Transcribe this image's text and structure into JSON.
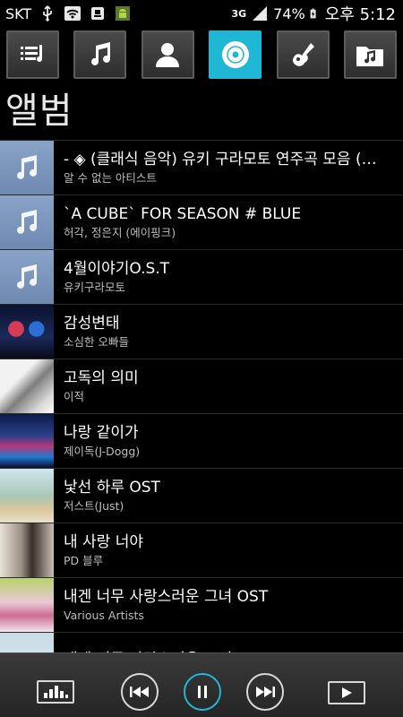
{
  "statusbar": {
    "carrier": "SKT",
    "network": "3G",
    "battery": "74%",
    "time": "오후 5:12"
  },
  "tabs": [
    {
      "name": "playlist",
      "icon": "playlist-icon",
      "active": false
    },
    {
      "name": "songs",
      "icon": "music-note-icon",
      "active": false
    },
    {
      "name": "artists",
      "icon": "person-icon",
      "active": false
    },
    {
      "name": "albums",
      "icon": "disc-icon",
      "active": true
    },
    {
      "name": "genres",
      "icon": "guitar-icon",
      "active": false
    },
    {
      "name": "folders",
      "icon": "music-folder-icon",
      "active": false
    }
  ],
  "page": {
    "title": "앨범"
  },
  "albums": [
    {
      "title": "- ◈ (클래식 음악) 유키 구라모토 연주곡 모음 (기타..",
      "artist": "알 수 없는 아티스트",
      "art": "note"
    },
    {
      "title": "`A CUBE` FOR SEASON # BLUE",
      "artist": "허각, 정은지 (에이핑크)",
      "art": "note"
    },
    {
      "title": "4월이야기O.S.T",
      "artist": "유키구라모토",
      "art": "note"
    },
    {
      "title": "감성변태",
      "artist": "소심한 오빠들",
      "art": "art1"
    },
    {
      "title": "고독의 의미",
      "artist": "이적",
      "art": "art2"
    },
    {
      "title": "나랑 같이가",
      "artist": "제이독(J-Dogg)",
      "art": "art3"
    },
    {
      "title": "낯선 하루 OST",
      "artist": "저스트(Just)",
      "art": "art4"
    },
    {
      "title": "내 사랑 너야",
      "artist": "PD 블루",
      "art": "art5"
    },
    {
      "title": "내겐 너무 사랑스러운 그녀 OST",
      "artist": "Various Artists",
      "art": "art6"
    },
    {
      "title": "내겐 너무 사랑스러운 그녀 OST",
      "artist": "",
      "art": "art7"
    }
  ],
  "colors": {
    "accent": "#1fb7d4",
    "note_art": "#7f98bd"
  }
}
